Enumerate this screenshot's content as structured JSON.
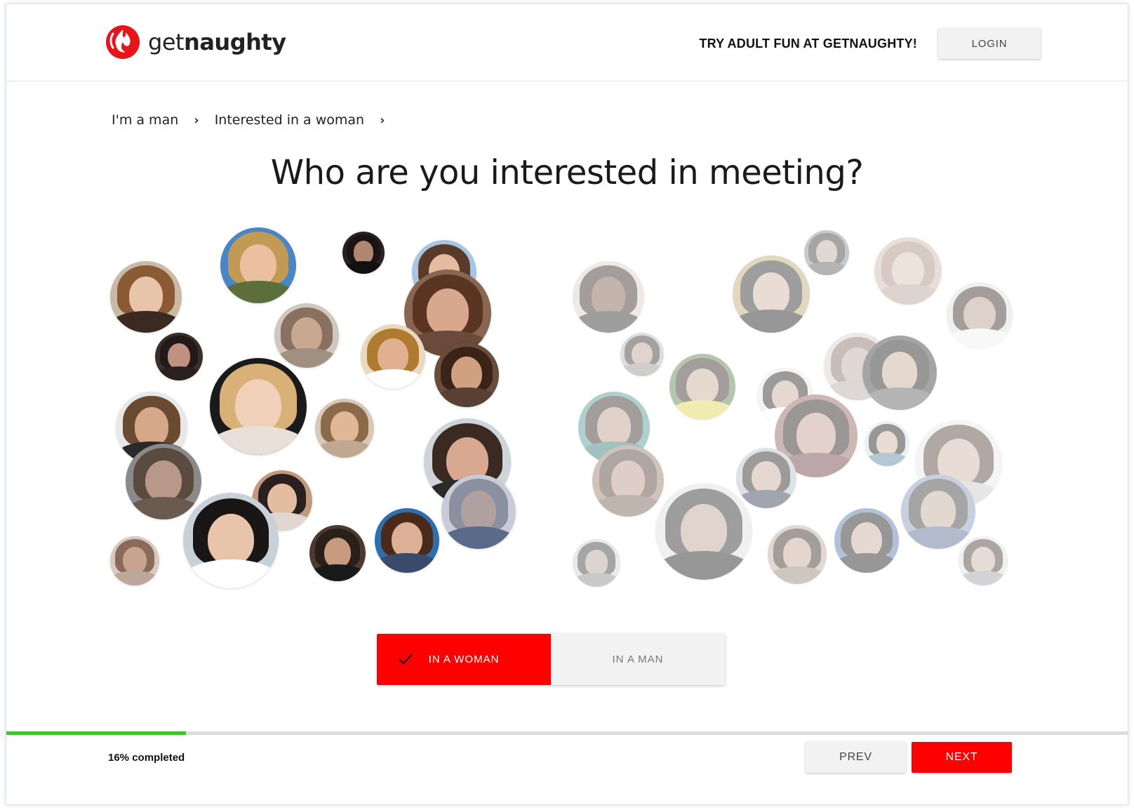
{
  "header": {
    "logo_light": "get",
    "logo_bold": "naughty",
    "cta_text": "TRY ADULT FUN AT GETNAUGHTY!",
    "login_label": "LOGIN"
  },
  "breadcrumb": {
    "items": [
      "I'm a man",
      "Interested in a woman"
    ]
  },
  "question": "Who are you interested in meeting?",
  "choice": {
    "options": [
      "IN A WOMAN",
      "IN A MAN"
    ],
    "selected": "IN A WOMAN"
  },
  "progress": {
    "percent": 16,
    "label": "16% completed"
  },
  "footer": {
    "prev_label": "PREV",
    "next_label": "NEXT"
  },
  "colors": {
    "accent": "#ff0000",
    "progress": "#3ec42a",
    "button_gray": "#f2f2f2"
  }
}
